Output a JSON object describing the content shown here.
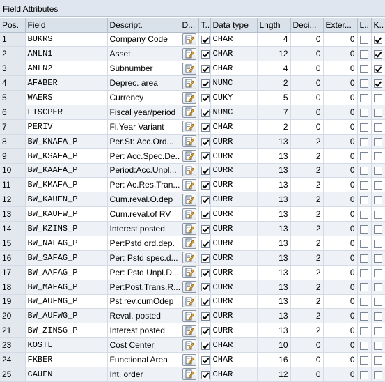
{
  "panel": {
    "title": "Field Attributes"
  },
  "columns": [
    "Pos.",
    "Field",
    "Descript.",
    "D...",
    "T..",
    "Data type",
    "Lngth",
    "Deci...",
    "Exter...",
    "L..",
    "K.."
  ],
  "rows": [
    {
      "pos": "1",
      "field": "BUKRS",
      "desc": "Company Code",
      "t": true,
      "type": "CHAR",
      "len": "4",
      "dec": "0",
      "ext": "0",
      "l": false,
      "k": true
    },
    {
      "pos": "2",
      "field": "ANLN1",
      "desc": "Asset",
      "t": true,
      "type": "CHAR",
      "len": "12",
      "dec": "0",
      "ext": "0",
      "l": false,
      "k": true
    },
    {
      "pos": "3",
      "field": "ANLN2",
      "desc": "Subnumber",
      "t": true,
      "type": "CHAR",
      "len": "4",
      "dec": "0",
      "ext": "0",
      "l": false,
      "k": true
    },
    {
      "pos": "4",
      "field": "AFABER",
      "desc": "Deprec. area",
      "t": true,
      "type": "NUMC",
      "len": "2",
      "dec": "0",
      "ext": "0",
      "l": false,
      "k": true
    },
    {
      "pos": "5",
      "field": "WAERS",
      "desc": "Currency",
      "t": true,
      "type": "CUKY",
      "len": "5",
      "dec": "0",
      "ext": "0",
      "l": false,
      "k": false
    },
    {
      "pos": "6",
      "field": "FISCPER",
      "desc": "Fiscal year/period",
      "t": true,
      "type": "NUMC",
      "len": "7",
      "dec": "0",
      "ext": "0",
      "l": false,
      "k": false
    },
    {
      "pos": "7",
      "field": "PERIV",
      "desc": "Fi.Year Variant",
      "t": true,
      "type": "CHAR",
      "len": "2",
      "dec": "0",
      "ext": "0",
      "l": false,
      "k": false
    },
    {
      "pos": "8",
      "field": "BW_KNAFA_P",
      "desc": "Per.St: Acc.Ord...",
      "t": true,
      "type": "CURR",
      "len": "13",
      "dec": "2",
      "ext": "0",
      "l": false,
      "k": false
    },
    {
      "pos": "9",
      "field": "BW_KSAFA_P",
      "desc": "Per: Acc.Spec.De...",
      "t": true,
      "type": "CURR",
      "len": "13",
      "dec": "2",
      "ext": "0",
      "l": false,
      "k": false
    },
    {
      "pos": "10",
      "field": "BW_KAAFA_P",
      "desc": "Period:Acc.Unpl...",
      "t": true,
      "type": "CURR",
      "len": "13",
      "dec": "2",
      "ext": "0",
      "l": false,
      "k": false
    },
    {
      "pos": "11",
      "field": "BW_KMAFA_P",
      "desc": "Per: Ac.Res.Tran...",
      "t": true,
      "type": "CURR",
      "len": "13",
      "dec": "2",
      "ext": "0",
      "l": false,
      "k": false
    },
    {
      "pos": "12",
      "field": "BW_KAUFN_P",
      "desc": "Cum.reval.O.dep",
      "t": true,
      "type": "CURR",
      "len": "13",
      "dec": "2",
      "ext": "0",
      "l": false,
      "k": false
    },
    {
      "pos": "13",
      "field": "BW_KAUFW_P",
      "desc": "Cum.reval.of RV",
      "t": true,
      "type": "CURR",
      "len": "13",
      "dec": "2",
      "ext": "0",
      "l": false,
      "k": false
    },
    {
      "pos": "14",
      "field": "BW_KZINS_P",
      "desc": "Interest posted",
      "t": true,
      "type": "CURR",
      "len": "13",
      "dec": "2",
      "ext": "0",
      "l": false,
      "k": false
    },
    {
      "pos": "15",
      "field": "BW_NAFAG_P",
      "desc": "Per:Pstd ord.dep.",
      "t": true,
      "type": "CURR",
      "len": "13",
      "dec": "2",
      "ext": "0",
      "l": false,
      "k": false
    },
    {
      "pos": "16",
      "field": "BW_SAFAG_P",
      "desc": "Per: Pstd spec.d...",
      "t": true,
      "type": "CURR",
      "len": "13",
      "dec": "2",
      "ext": "0",
      "l": false,
      "k": false
    },
    {
      "pos": "17",
      "field": "BW_AAFAG_P",
      "desc": "Per: Pstd Unpl.D...",
      "t": true,
      "type": "CURR",
      "len": "13",
      "dec": "2",
      "ext": "0",
      "l": false,
      "k": false
    },
    {
      "pos": "18",
      "field": "BW_MAFAG_P",
      "desc": "Per:Post.Trans.R...",
      "t": true,
      "type": "CURR",
      "len": "13",
      "dec": "2",
      "ext": "0",
      "l": false,
      "k": false
    },
    {
      "pos": "19",
      "field": "BW_AUFNG_P",
      "desc": "Pst.rev.cumOdep",
      "t": true,
      "type": "CURR",
      "len": "13",
      "dec": "2",
      "ext": "0",
      "l": false,
      "k": false
    },
    {
      "pos": "20",
      "field": "BW_AUFWG_P",
      "desc": "Reval. posted",
      "t": true,
      "type": "CURR",
      "len": "13",
      "dec": "2",
      "ext": "0",
      "l": false,
      "k": false
    },
    {
      "pos": "21",
      "field": "BW_ZINSG_P",
      "desc": "Interest posted",
      "t": true,
      "type": "CURR",
      "len": "13",
      "dec": "2",
      "ext": "0",
      "l": false,
      "k": false
    },
    {
      "pos": "23",
      "field": "KOSTL",
      "desc": "Cost Center",
      "t": true,
      "type": "CHAR",
      "len": "10",
      "dec": "0",
      "ext": "0",
      "l": false,
      "k": false
    },
    {
      "pos": "24",
      "field": "FKBER",
      "desc": "Functional Area",
      "t": true,
      "type": "CHAR",
      "len": "16",
      "dec": "0",
      "ext": "0",
      "l": false,
      "k": false
    },
    {
      "pos": "25",
      "field": "CAUFN",
      "desc": "Int. order",
      "t": true,
      "type": "CHAR",
      "len": "12",
      "dec": "0",
      "ext": "0",
      "l": false,
      "k": false
    }
  ],
  "icons": {
    "detail": "edit-document-icon"
  }
}
